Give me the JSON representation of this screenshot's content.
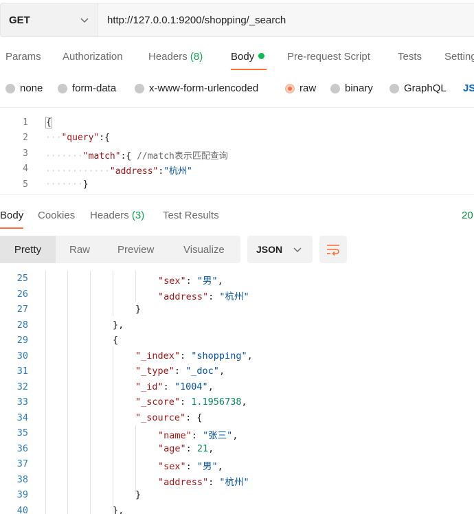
{
  "request": {
    "method": "GET",
    "url": "http://127.0.0.1:9200/shopping/_search"
  },
  "request_tabs": [
    {
      "label": "Params"
    },
    {
      "label": "Authorization"
    },
    {
      "label": "Headers",
      "count": "(8)"
    },
    {
      "label": "Body",
      "active": true
    },
    {
      "label": "Pre-request Script"
    },
    {
      "label": "Tests"
    },
    {
      "label": "Settings"
    }
  ],
  "body_types": [
    "none",
    "form-data",
    "x-www-form-urlencoded",
    "raw",
    "binary",
    "GraphQL",
    "JSON"
  ],
  "body_type_selected": "raw",
  "request_body_lines": [
    {
      "n": "1",
      "text": "{"
    },
    {
      "n": "2",
      "text": "\"query\":{"
    },
    {
      "n": "3",
      "text": "\"match\":{ //match表示匹配查询"
    },
    {
      "n": "4",
      "text": "\"address\":\"杭州\""
    },
    {
      "n": "5",
      "text": "}"
    }
  ],
  "response_tabs": [
    {
      "label": "Body",
      "active": true
    },
    {
      "label": "Cookies"
    },
    {
      "label": "Headers",
      "count": "(3)"
    },
    {
      "label": "Test Results"
    }
  ],
  "response_status": "20",
  "response_view_modes": [
    "Pretty",
    "Raw",
    "Preview",
    "Visualize"
  ],
  "response_format": "JSON",
  "response_lines": [
    {
      "n": "25",
      "text": "\"sex\": \"男\","
    },
    {
      "n": "26",
      "text": "\"address\": \"杭州\""
    },
    {
      "n": "27",
      "text": "}"
    },
    {
      "n": "28",
      "text": "},"
    },
    {
      "n": "29",
      "text": "{"
    },
    {
      "n": "30",
      "text": "\"_index\": \"shopping\","
    },
    {
      "n": "31",
      "text": "\"_type\": \"_doc\","
    },
    {
      "n": "32",
      "text": "\"_id\": \"1004\","
    },
    {
      "n": "33",
      "text": "\"_score\": 1.1956738,"
    },
    {
      "n": "34",
      "text": "\"_source\": {"
    },
    {
      "n": "35",
      "text": "\"name\": \"张三\","
    },
    {
      "n": "36",
      "text": "\"age\": 21,"
    },
    {
      "n": "37",
      "text": "\"sex\": \"男\","
    },
    {
      "n": "38",
      "text": "\"address\": \"杭州\""
    },
    {
      "n": "39",
      "text": "}"
    },
    {
      "n": "40",
      "text": "},"
    }
  ],
  "colors": {
    "accent": "#ff6c37",
    "active_dot": "#0cbb52",
    "count": "#10a350"
  },
  "icons": [
    "chevron-down-icon",
    "wrap-lines-icon"
  ]
}
